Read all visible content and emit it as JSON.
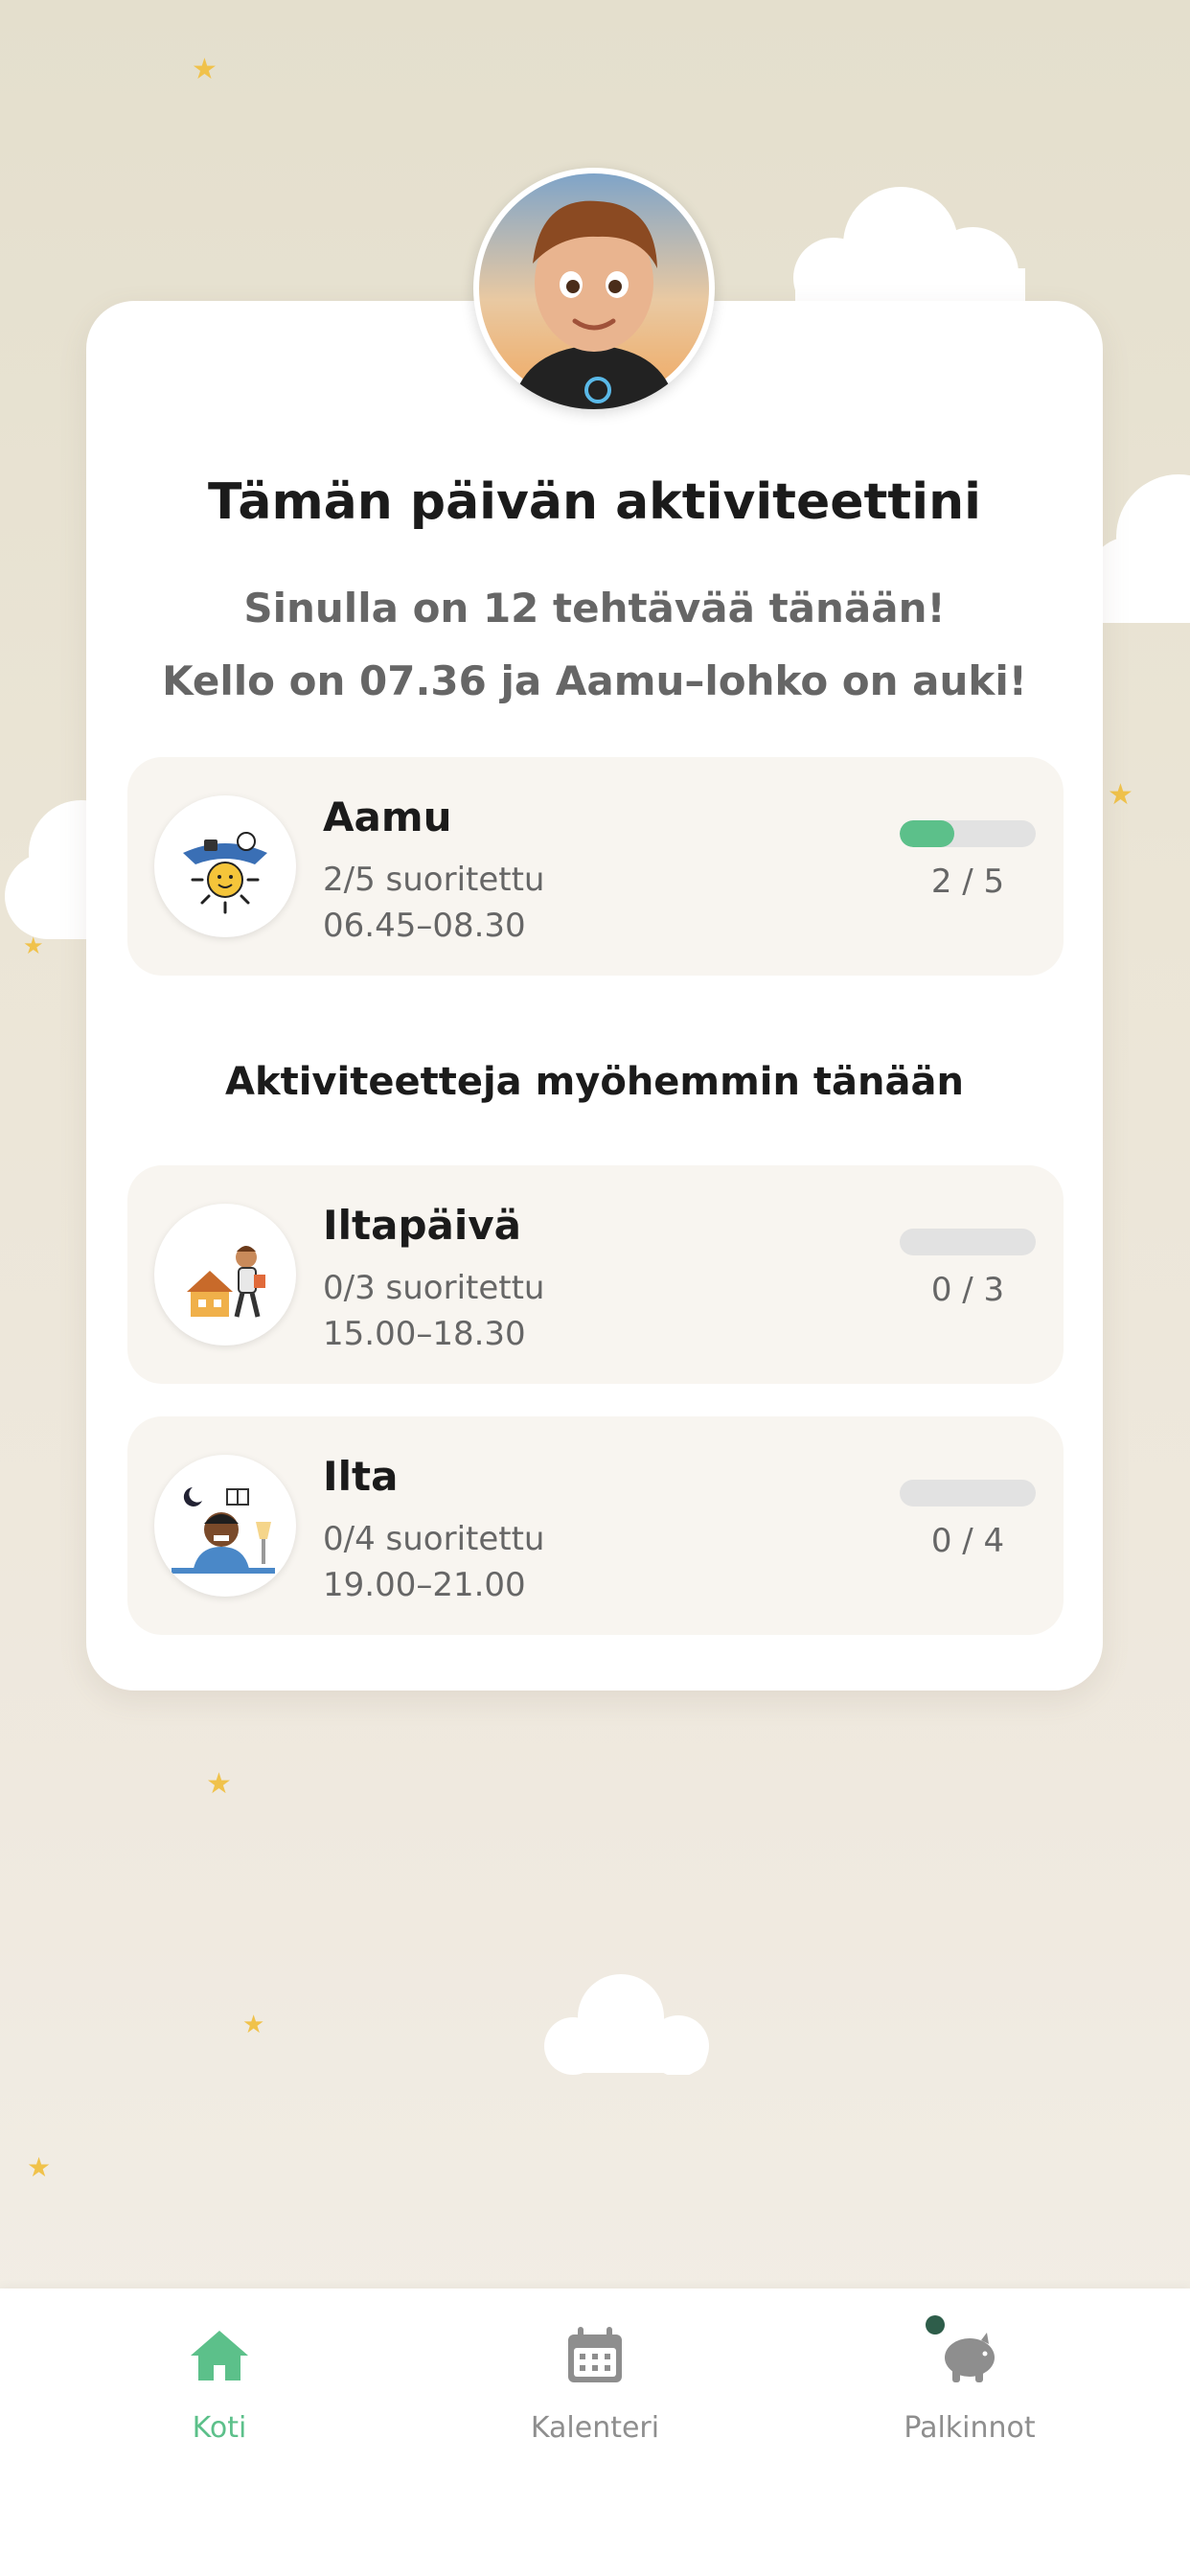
{
  "main": {
    "title": "Tämän päivän aktiviteettini",
    "subtitle_tasks": "Sinulla on 12 tehtävää tänään!",
    "subtitle_time": "Kello on 07.36 ja Aamu–lohko on auki!",
    "later_heading": "Aktiviteetteja myöhemmin tänään"
  },
  "current_block": {
    "name": "Aamu",
    "completed": "2/5 suoritettu",
    "time_range": "06.45–08.30",
    "progress_text": "2 / 5",
    "progress_fraction": 0.4,
    "icon": "morning-sun-icon"
  },
  "later_blocks": [
    {
      "name": "Iltapäivä",
      "completed": "0/3 suoritettu",
      "time_range": "15.00–18.30",
      "progress_text": "0 / 3",
      "progress_fraction": 0,
      "icon": "afternoon-kid-icon"
    },
    {
      "name": "Ilta",
      "completed": "0/4 suoritettu",
      "time_range": "19.00–21.00",
      "progress_text": "0 / 4",
      "progress_fraction": 0,
      "icon": "evening-kid-icon"
    }
  ],
  "nav": {
    "items": [
      {
        "label": "Koti",
        "icon": "home-icon",
        "active": true
      },
      {
        "label": "Kalenteri",
        "icon": "calendar-icon",
        "active": false
      },
      {
        "label": "Palkinnot",
        "icon": "piggy-bank-icon",
        "active": false
      }
    ]
  },
  "colors": {
    "accent": "#5cc08a",
    "inactive": "#8e8e8e",
    "star": "#f0c24b",
    "block_background": "#f8f5f0"
  }
}
